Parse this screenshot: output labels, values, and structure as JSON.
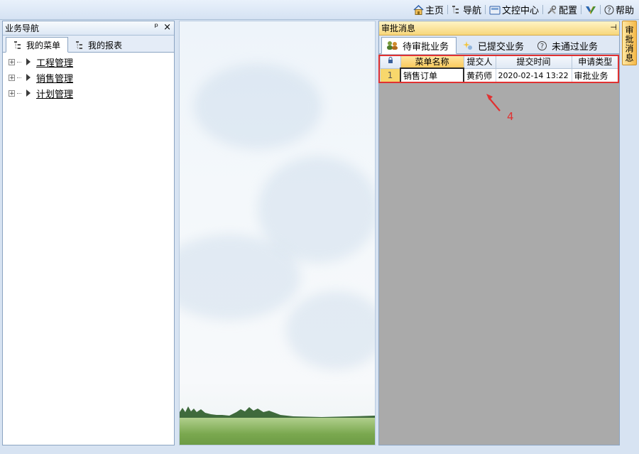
{
  "toolbar": {
    "items": [
      {
        "label": "主页",
        "icon": "home-icon"
      },
      {
        "label": "导航",
        "icon": "tree-icon"
      },
      {
        "label": "文控中心",
        "icon": "folder-icon"
      },
      {
        "label": "配置",
        "icon": "tools-icon"
      },
      {
        "label": "",
        "icon": "brand-logo-icon"
      },
      {
        "label": "帮助",
        "icon": "help-icon"
      }
    ],
    "help_glyph": "?"
  },
  "left_panel": {
    "title": "业务导航",
    "pin_glyph": "ᵖ",
    "close_glyph": "×",
    "tabs": [
      {
        "label": "我的菜单",
        "active": true
      },
      {
        "label": "我的报表",
        "active": false
      }
    ],
    "tree": [
      {
        "label": "工程管理"
      },
      {
        "label": "销售管理"
      },
      {
        "label": "计划管理"
      }
    ],
    "expander_glyph": "+"
  },
  "right_panel": {
    "title": "审批消息",
    "tabs": [
      {
        "label": "待审批业务",
        "active": true
      },
      {
        "label": "已提交业务",
        "active": false
      },
      {
        "label": "未通过业务",
        "active": false
      }
    ],
    "help_glyph": "?",
    "grid": {
      "columns": [
        "菜单名称",
        "提交人",
        "提交时间",
        "申请类型"
      ],
      "rows": [
        {
          "num": "1",
          "cells": [
            "销售订单",
            "黄药师",
            "2020-02-14 13:22",
            "审批业务"
          ]
        }
      ]
    }
  },
  "side_tab": {
    "label": "审批消息"
  },
  "annotation": {
    "label": "4"
  },
  "colors": {
    "accent": "#f7d77b",
    "highlight": "#e03131",
    "panel_border": "#8ba4c2"
  }
}
